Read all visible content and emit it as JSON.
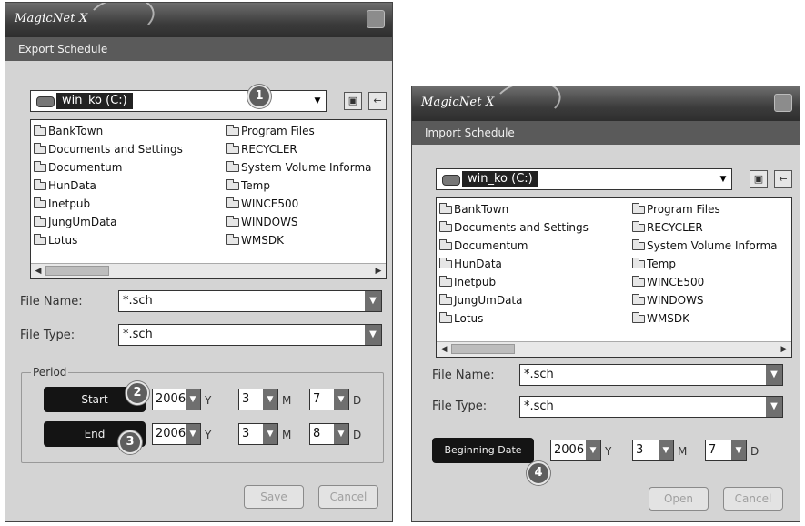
{
  "export_dialog": {
    "brand": "MagicNet X",
    "subtitle": "Export Schedule",
    "drive": "win_ko (C:)",
    "files_col1": [
      "BankTown",
      "Documents and Settings",
      "Documentum",
      "HunData",
      "Inetpub",
      "JungUmData",
      "Lotus"
    ],
    "files_col2": [
      "Program Files",
      "RECYCLER",
      "System Volume Informa",
      "Temp",
      "WINCE500",
      "WINDOWS",
      "WMSDK"
    ],
    "file_name_label": "File Name:",
    "file_name_value": "*.sch",
    "file_type_label": "File Type:",
    "file_type_value": "*.sch",
    "period_label": "Period",
    "start_label": "Start",
    "end_label": "End",
    "start_year": "2006",
    "start_month": "3",
    "start_day": "7",
    "end_year": "2006",
    "end_month": "3",
    "end_day": "8",
    "unit_y": "Y",
    "unit_m": "M",
    "unit_d": "D",
    "save_label": "Save",
    "cancel_label": "Cancel"
  },
  "import_dialog": {
    "brand": "MagicNet X",
    "subtitle": "Import Schedule",
    "drive": "win_ko (C:)",
    "files_col1": [
      "BankTown",
      "Documents and Settings",
      "Documentum",
      "HunData",
      "Inetpub",
      "JungUmData",
      "Lotus"
    ],
    "files_col2": [
      "Program Files",
      "RECYCLER",
      "System Volume Informa",
      "Temp",
      "WINCE500",
      "WINDOWS",
      "WMSDK"
    ],
    "file_name_label": "File Name:",
    "file_name_value": "*.sch",
    "file_type_label": "File Type:",
    "file_type_value": "*.sch",
    "beginning_date_label": "Beginning Date",
    "year": "2006",
    "month": "3",
    "day": "7",
    "unit_y": "Y",
    "unit_m": "M",
    "unit_d": "D",
    "open_label": "Open",
    "cancel_label": "Cancel"
  },
  "callouts": [
    "1",
    "2",
    "3",
    "4"
  ]
}
